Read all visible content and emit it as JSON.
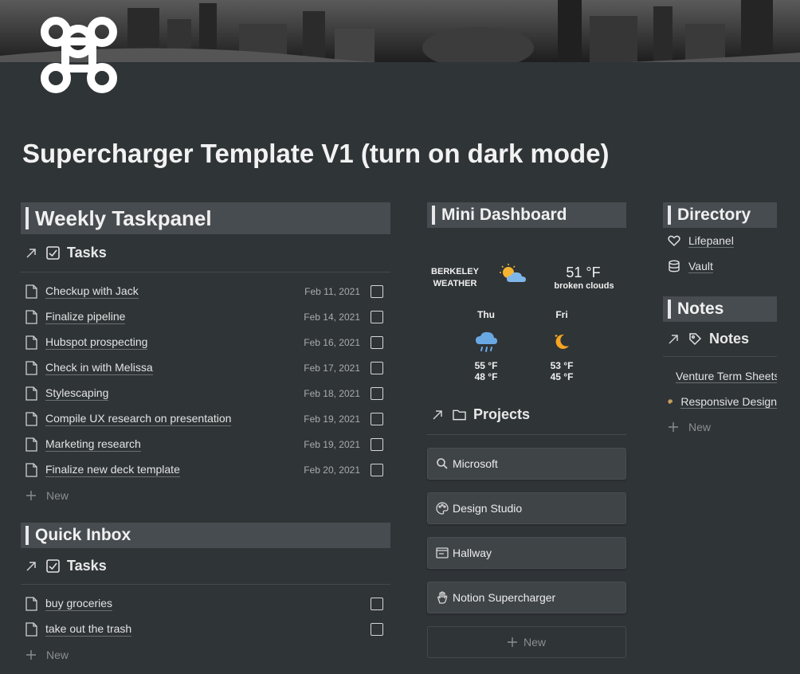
{
  "page": {
    "title": "Supercharger Template V1 (turn on dark mode)",
    "icon": "command-key-icon",
    "cover": "dark-cityscape-image"
  },
  "weekly_taskpanel": {
    "heading": "Weekly Taskpanel",
    "view_label": "Tasks",
    "tasks": [
      {
        "name": "Checkup with Jack",
        "date": "Feb 11, 2021"
      },
      {
        "name": "Finalize pipeline",
        "date": "Feb 14, 2021"
      },
      {
        "name": "Hubspot prospecting",
        "date": "Feb 16, 2021"
      },
      {
        "name": "Check in with Melissa",
        "date": "Feb 17, 2021"
      },
      {
        "name": "Stylescaping",
        "date": "Feb 18, 2021"
      },
      {
        "name": "Compile UX research on presentation",
        "date": "Feb 19, 2021"
      },
      {
        "name": "Marketing research",
        "date": "Feb 19, 2021"
      },
      {
        "name": "Finalize new deck template",
        "date": "Feb 20, 2021"
      }
    ],
    "new_label": "New"
  },
  "quick_inbox": {
    "heading": "Quick Inbox",
    "view_label": "Tasks",
    "tasks": [
      {
        "name": "buy groceries"
      },
      {
        "name": "take out the trash"
      }
    ],
    "new_label": "New"
  },
  "mini_dashboard": {
    "heading": "Mini Dashboard",
    "weather": {
      "city_line1": "BERKELEY",
      "city_line2": "WEATHER",
      "current_temp": "51 °F",
      "current_desc": "broken clouds",
      "forecast": [
        {
          "day": "Thu",
          "icon": "rain-cloud-icon",
          "hi": "55 °F",
          "lo": "48 °F"
        },
        {
          "day": "Fri",
          "icon": "moon-icon",
          "hi": "53 °F",
          "lo": "45 °F"
        }
      ]
    }
  },
  "projects": {
    "view_label": "Projects",
    "items": [
      {
        "name": "Microsoft",
        "icon": "search-icon"
      },
      {
        "name": "Design Studio",
        "icon": "palette-icon"
      },
      {
        "name": "Hallway",
        "icon": "window-icon"
      },
      {
        "name": "Notion Supercharger",
        "icon": "hand-icon"
      }
    ],
    "new_label": "New"
  },
  "directory": {
    "heading": "Directory",
    "items": [
      {
        "name": "Lifepanel",
        "icon": "heart-icon"
      },
      {
        "name": "Vault",
        "icon": "database-icon"
      }
    ]
  },
  "notes": {
    "heading": "Notes",
    "view_label": "Notes",
    "items": [
      {
        "name": "Venture Term Sheets",
        "icon": "scroll-icon"
      },
      {
        "name": "Responsive Design",
        "icon": "palette-icon"
      }
    ],
    "new_label": "New"
  }
}
